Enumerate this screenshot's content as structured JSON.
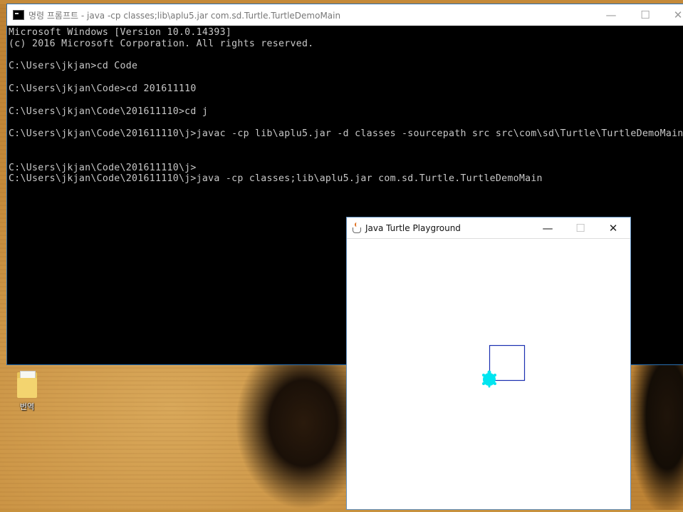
{
  "desktop": {
    "icon_label": "번역"
  },
  "cmd": {
    "title": "명령 프롬프트 - java  -cp classes;lib\\aplu5.jar com.sd.Turtle.TurtleDemoMain",
    "minimize": "—",
    "maximize": "☐",
    "close": "✕",
    "lines": [
      "Microsoft Windows [Version 10.0.14393]",
      "(c) 2016 Microsoft Corporation. All rights reserved.",
      "",
      "C:\\Users\\jkjan>cd Code",
      "",
      "C:\\Users\\jkjan\\Code>cd 201611110",
      "",
      "C:\\Users\\jkjan\\Code\\201611110>cd j",
      "",
      "C:\\Users\\jkjan\\Code\\201611110\\j>javac -cp lib\\aplu5.jar -d classes -sourcepath src src\\com\\sd\\Turtle\\TurtleDemoMain.java",
      "",
      "",
      "C:\\Users\\jkjan\\Code\\201611110\\j>",
      "C:\\Users\\jkjan\\Code\\201611110\\j>java -cp classes;lib\\aplu5.jar com.sd.Turtle.TurtleDemoMain"
    ]
  },
  "java_window": {
    "title": "Java Turtle Playground",
    "minimize": "—",
    "maximize": "☐",
    "close": "✕",
    "colors": {
      "square_stroke": "#1a2fb0",
      "turtle": "#00e5f0"
    }
  }
}
